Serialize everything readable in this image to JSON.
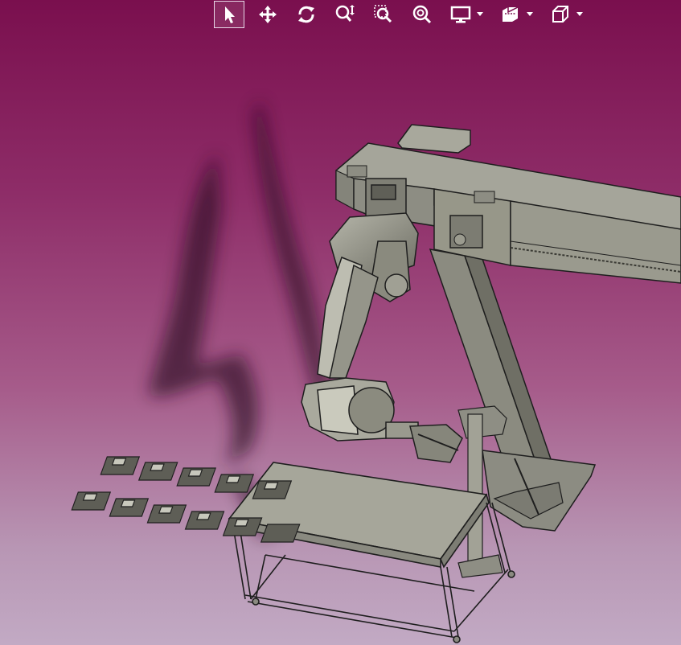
{
  "toolbar": {
    "buttons": [
      {
        "icon": "select-arrow-icon",
        "active": true
      },
      {
        "icon": "pan-icon"
      },
      {
        "icon": "rotate-icon"
      },
      {
        "icon": "zoom-dynamic-icon"
      },
      {
        "icon": "zoom-window-icon"
      },
      {
        "icon": "zoom-fit-icon"
      },
      {
        "icon": "display-mode-icon",
        "dropdown": true
      },
      {
        "icon": "section-view-icon",
        "dropdown": true
      },
      {
        "icon": "view-cube-icon",
        "dropdown": true
      }
    ]
  },
  "colors": {
    "background_top": "#7a0f4e",
    "background_bottom": "#c2aac4",
    "model_fill": "#8a8a7c",
    "model_light": "#b4b4a8",
    "model_edge": "#1e1e1e",
    "icon": "#ffffff"
  }
}
